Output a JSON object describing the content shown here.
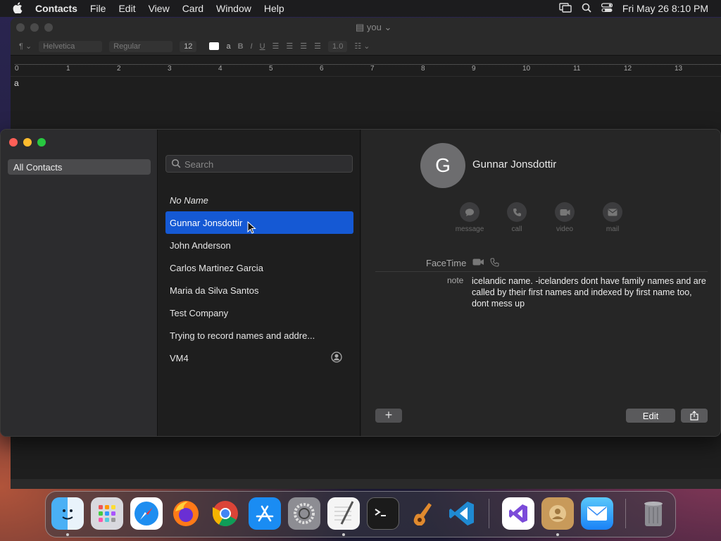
{
  "menubar": {
    "app_name": "Contacts",
    "items": [
      "File",
      "Edit",
      "View",
      "Card",
      "Window",
      "Help"
    ],
    "datetime": "Fri May 26  8:10 PM"
  },
  "textedit": {
    "doc_title": "you",
    "font_family": "Helvetica",
    "font_style": "Regular",
    "font_size": "12",
    "line_spacing": "1.0",
    "ruler_numbers": [
      "0",
      "1",
      "2",
      "3",
      "4",
      "5",
      "6",
      "7",
      "8",
      "9",
      "10",
      "11",
      "12",
      "13"
    ],
    "body_text": "a"
  },
  "contacts": {
    "sidebar": {
      "all_contacts_label": "All Contacts"
    },
    "search": {
      "placeholder": "Search"
    },
    "list": [
      {
        "label": "No Name"
      },
      {
        "label": "Gunnar Jonsdottir"
      },
      {
        "label": "John Anderson"
      },
      {
        "label": "Carlos Martinez Garcia"
      },
      {
        "label": "Maria da Silva Santos"
      },
      {
        "label": "Test Company"
      },
      {
        "label": "Trying to record names and addre..."
      },
      {
        "label": "VM4"
      }
    ],
    "detail": {
      "avatar_initial": "G",
      "name": "Gunnar Jonsdottir",
      "actions": {
        "message": "message",
        "call": "call",
        "video": "video",
        "mail": "mail"
      },
      "facetime_label": "FaceTime",
      "note_label": "note",
      "note_text": "icelandic name. -icelanders dont have family names and are called by their first names and indexed by first name too, dont mess up",
      "edit_label": "Edit",
      "add_label": "+"
    }
  },
  "dock": {
    "apps": [
      "finder-icon",
      "launchpad-icon",
      "safari-icon",
      "firefox-icon",
      "chrome-icon",
      "app-store-icon",
      "system-settings-icon",
      "textedit-icon",
      "terminal-icon",
      "garageband-icon",
      "vscode-icon",
      "visual-studio-icon",
      "contacts-icon",
      "mail-icon",
      "trash-icon"
    ]
  }
}
